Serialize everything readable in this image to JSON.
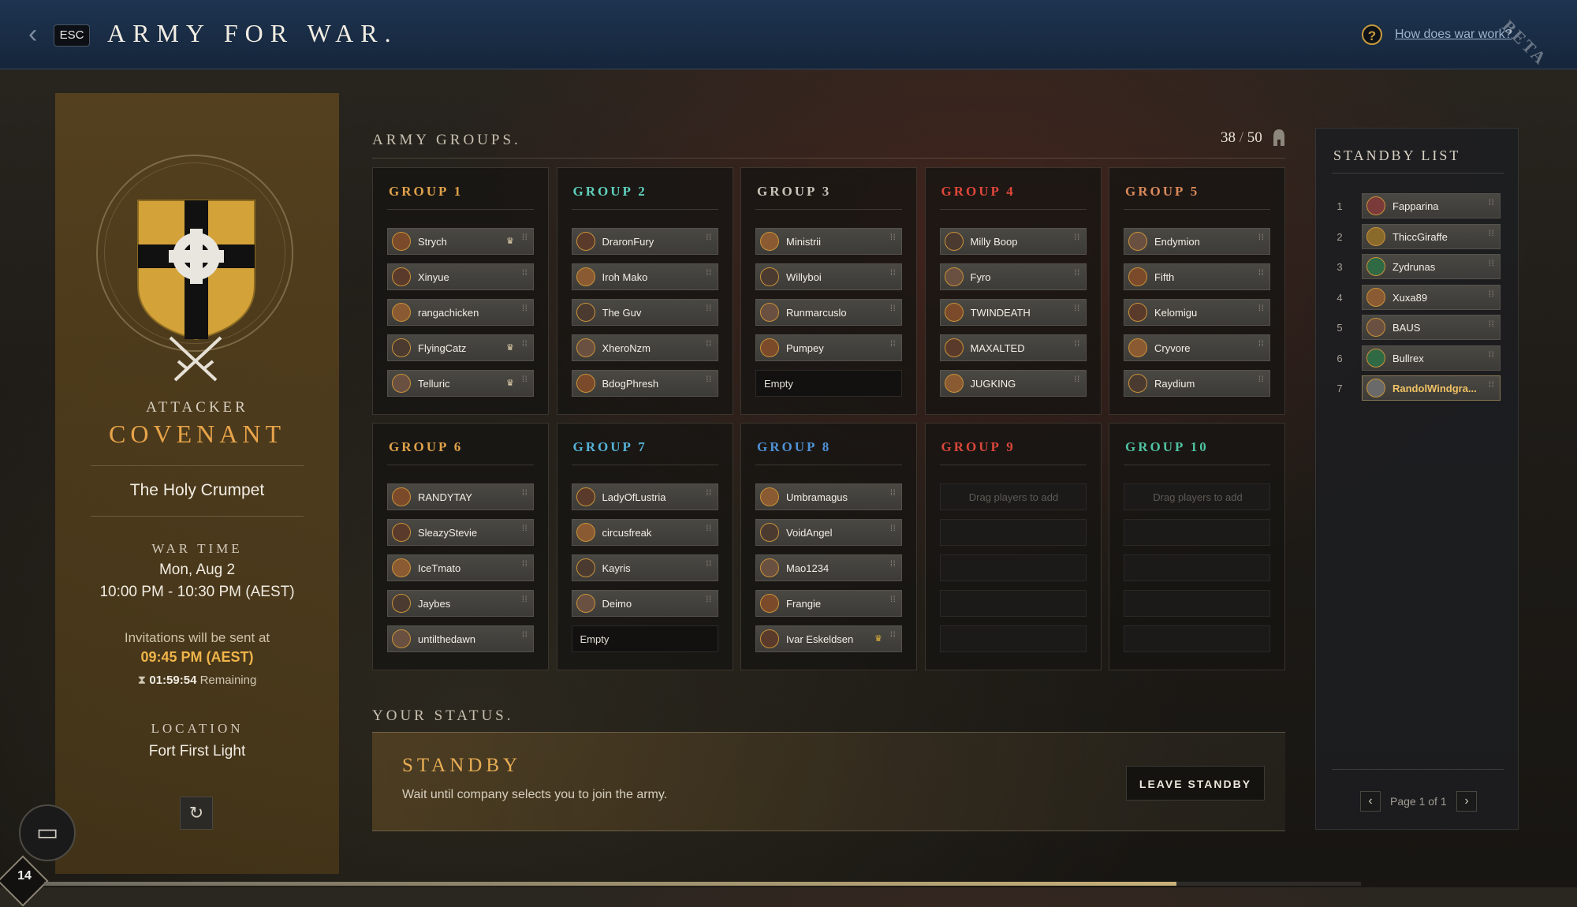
{
  "header": {
    "esc_label": "ESC",
    "title": "ARMY FOR WAR.",
    "help_link": "How does war work?",
    "help_icon": "question-icon",
    "watermark": "BETA"
  },
  "war_info": {
    "role": "ATTACKER",
    "company": "COVENANT",
    "settlement": "The Holy Crumpet",
    "war_time_label": "WAR TIME",
    "war_date": "Mon, Aug 2",
    "war_time": "10:00 PM - 10:30 PM  (AEST)",
    "invite_label": "Invitations will be sent at",
    "invite_time": "09:45 PM  (AEST)",
    "countdown": "01:59:54",
    "countdown_suffix": "Remaining",
    "location_label": "LOCATION",
    "location": "Fort First Light",
    "accent_color": "#e8a44a"
  },
  "army": {
    "heading": "ARMY GROUPS.",
    "count": "38",
    "max": "50",
    "groups": [
      {
        "title": "GROUP 1",
        "color": "#e0a24b",
        "slots": [
          {
            "name": "Strych",
            "crown": true
          },
          {
            "name": "Xinyue",
            "crown": false
          },
          {
            "name": "rangachicken",
            "crown": false
          },
          {
            "name": "FlyingCatz",
            "crown": true
          },
          {
            "name": "Telluric",
            "crown": true
          }
        ]
      },
      {
        "title": "GROUP 2",
        "color": "#5fd0bd",
        "slots": [
          {
            "name": "DraronFury"
          },
          {
            "name": "Iroh Mako"
          },
          {
            "name": "The Guv"
          },
          {
            "name": "XheroNzm"
          },
          {
            "name": "BdogPhresh"
          }
        ]
      },
      {
        "title": "GROUP 3",
        "color": "#c8c3b8",
        "slots": [
          {
            "name": "Ministrii"
          },
          {
            "name": "Willyboi"
          },
          {
            "name": "Runmarcuslo"
          },
          {
            "name": "Pumpey"
          },
          {
            "name": "Empty",
            "empty": true
          }
        ]
      },
      {
        "title": "GROUP 4",
        "color": "#e0473a",
        "slots": [
          {
            "name": "Milly Boop"
          },
          {
            "name": "Fyro"
          },
          {
            "name": "TWINDEATH"
          },
          {
            "name": "MAXALTED"
          },
          {
            "name": "JUGKING"
          }
        ]
      },
      {
        "title": "GROUP 5",
        "color": "#d98a5a",
        "slots": [
          {
            "name": "Endymion"
          },
          {
            "name": "Fifth"
          },
          {
            "name": "Kelomigu"
          },
          {
            "name": "Cryvore"
          },
          {
            "name": "Raydium"
          }
        ]
      },
      {
        "title": "GROUP 6",
        "color": "#e0a24b",
        "slots": [
          {
            "name": "RANDYTAY"
          },
          {
            "name": "SleazyStevie"
          },
          {
            "name": "IceTmato"
          },
          {
            "name": "Jaybes"
          },
          {
            "name": "untilthedawn"
          }
        ]
      },
      {
        "title": "GROUP 7",
        "color": "#56b3d9",
        "slots": [
          {
            "name": "LadyOfLustria"
          },
          {
            "name": "circusfreak"
          },
          {
            "name": "Kayris"
          },
          {
            "name": "Deimo"
          },
          {
            "name": "Empty",
            "empty": true
          }
        ]
      },
      {
        "title": "GROUP 8",
        "color": "#4f92d6",
        "slots": [
          {
            "name": "Umbramagus"
          },
          {
            "name": "VoidAngel"
          },
          {
            "name": "Mao1234"
          },
          {
            "name": "Frangie"
          },
          {
            "name": "Ivar Eskeldsen",
            "crown": true,
            "gold": true
          }
        ]
      },
      {
        "title": "GROUP 9",
        "color": "#d9463b",
        "slots": [
          {
            "name": "Drag players to add",
            "placeholder": true
          },
          {
            "name": "",
            "placeholder": true
          },
          {
            "name": "",
            "placeholder": true
          },
          {
            "name": "",
            "placeholder": true
          },
          {
            "name": "",
            "placeholder": true
          }
        ]
      },
      {
        "title": "GROUP 10",
        "color": "#4fc3a1",
        "slots": [
          {
            "name": "Drag players to add",
            "placeholder": true
          },
          {
            "name": "",
            "placeholder": true
          },
          {
            "name": "",
            "placeholder": true
          },
          {
            "name": "",
            "placeholder": true
          },
          {
            "name": "",
            "placeholder": true
          }
        ]
      }
    ]
  },
  "status": {
    "heading": "YOUR STATUS.",
    "state": "STANDBY",
    "description": "Wait until company selects you to join the army.",
    "button": "LEAVE STANDBY"
  },
  "standby": {
    "heading": "STANDBY LIST",
    "entries": [
      {
        "num": "1",
        "name": "Fapparina"
      },
      {
        "num": "2",
        "name": "ThiccGiraffe"
      },
      {
        "num": "3",
        "name": "Zydrunas"
      },
      {
        "num": "4",
        "name": "Xuxa89"
      },
      {
        "num": "5",
        "name": "BAUS"
      },
      {
        "num": "6",
        "name": "Bullrex"
      },
      {
        "num": "7",
        "name": "RandolWindgra...",
        "me": true
      }
    ],
    "page_text": "Page 1 of 1"
  },
  "player": {
    "level": "14",
    "xp_progress": 0.86
  }
}
